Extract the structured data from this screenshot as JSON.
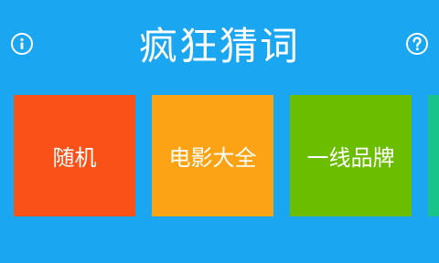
{
  "app": {
    "title": "疯狂猜词",
    "background": "#1aa6f0"
  },
  "header": {
    "info_icon": "info-icon",
    "help_icon": "question-mark-icon"
  },
  "categories": [
    {
      "label": "随机",
      "color": "#fa5117"
    },
    {
      "label": "电影大全",
      "color": "#fca315"
    },
    {
      "label": "一线品牌",
      "color": "#6bbd00"
    },
    {
      "label": "",
      "color": "#19c48a"
    }
  ]
}
